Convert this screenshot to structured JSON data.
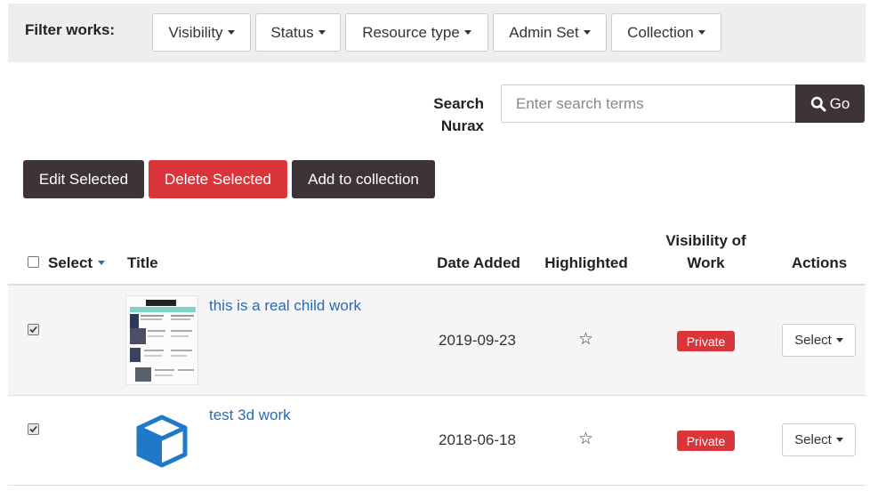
{
  "filters": {
    "label": "Filter works:",
    "buttons": [
      "Visibility",
      "Status",
      "Resource type",
      "Admin Set",
      "Collection"
    ]
  },
  "search": {
    "label_line1": "Search",
    "label_line2": "Nurax",
    "placeholder": "Enter search terms",
    "go_label": "Go"
  },
  "actions": {
    "edit": "Edit Selected",
    "delete": "Delete Selected",
    "add_to_collection": "Add to collection"
  },
  "table": {
    "headers": {
      "select": "Select",
      "title": "Title",
      "date_added": "Date Added",
      "highlighted": "Highlighted",
      "visibility_line1": "Visibility of",
      "visibility_line2": "Work",
      "actions": "Actions"
    },
    "rows": [
      {
        "title": "this is a real child work",
        "date": "2019-09-23",
        "visibility": "Private",
        "action": "Select",
        "thumbnail": "document-thumbnail"
      },
      {
        "title": "test 3d work",
        "date": "2018-06-18",
        "visibility": "Private",
        "action": "Select",
        "thumbnail": "cube-icon"
      }
    ]
  },
  "colors": {
    "primary_dark": "#3e3336",
    "danger": "#d9353a",
    "link": "#2a6bb1",
    "cube": "#1f78c8"
  }
}
